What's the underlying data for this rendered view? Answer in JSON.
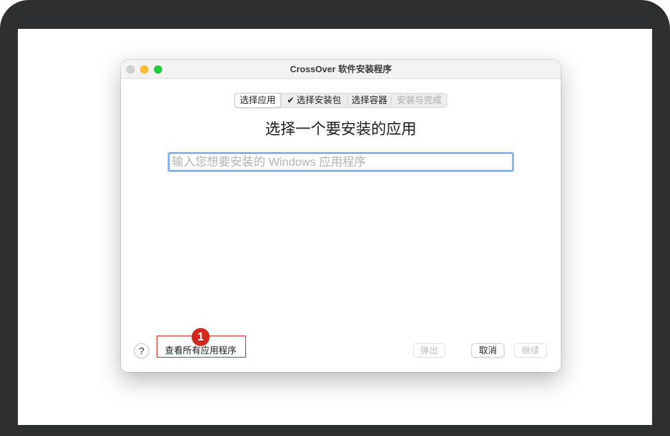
{
  "window": {
    "title": "CrossOver 软件安装程序",
    "controls": [
      {
        "icon": "close-icon",
        "color": "#d1d0d1"
      },
      {
        "icon": "minimize-icon",
        "color": "#febc2e"
      },
      {
        "icon": "zoom-icon",
        "color": "#28c840"
      }
    ]
  },
  "steps": [
    {
      "label": "选择应用",
      "selected": true,
      "enabled": true
    },
    {
      "check": "✔",
      "label": "选择安装包",
      "selected": false,
      "enabled": true
    },
    {
      "label": "选择容器",
      "selected": false,
      "enabled": true
    },
    {
      "label": "安装与完成",
      "selected": false,
      "enabled": false
    }
  ],
  "heading": "选择一个要安装的应用",
  "search": {
    "placeholder": "输入您想要安装的 Windows 应用程序"
  },
  "footer": {
    "help_label": "?",
    "view_all_label": "查看所有应用程序",
    "buttons": [
      {
        "label": "弹出",
        "enabled": false
      },
      {
        "label": "取消",
        "enabled": true
      },
      {
        "label": "继续",
        "enabled": false
      }
    ]
  },
  "annotation": {
    "badge": "1",
    "color": "#d2281e"
  },
  "colors": {
    "bezel": "#2e2f31",
    "focus_ring": "#8db3ec",
    "text_disabled": "#bdbdbd"
  }
}
